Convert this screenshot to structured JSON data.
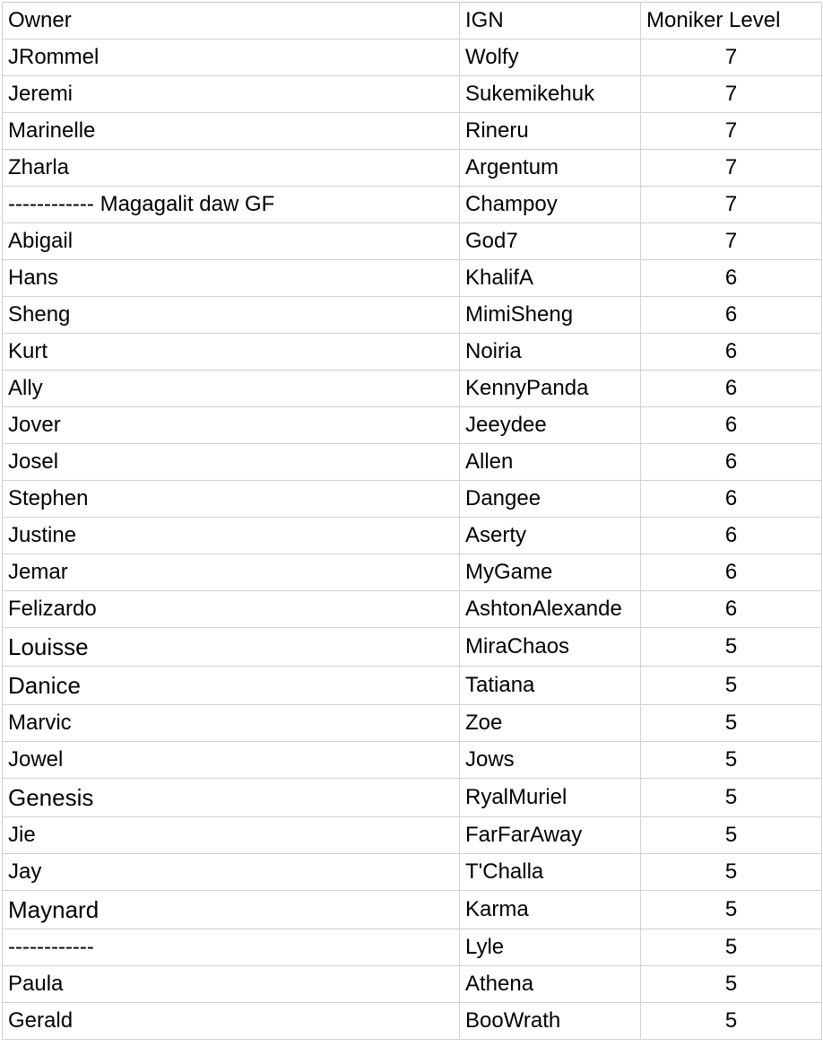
{
  "headers": {
    "owner": "Owner",
    "ign": "IGN",
    "level": "Moniker Level"
  },
  "rows": [
    {
      "owner": "JRommel",
      "ign": "Wolfy",
      "level": "7"
    },
    {
      "owner": "Jeremi",
      "ign": "Sukemikehuk",
      "level": "7"
    },
    {
      "owner": "Marinelle",
      "ign": "Rineru",
      "level": "7"
    },
    {
      "owner": "Zharla",
      "ign": "Argentum",
      "level": "7"
    },
    {
      "owner": "------------ Magagalit daw GF",
      "ign": "Champoy",
      "level": "7"
    },
    {
      "owner": "Abigail",
      "ign": "God7",
      "level": "7"
    },
    {
      "owner": "Hans",
      "ign": "KhalifA",
      "level": "6"
    },
    {
      "owner": "Sheng",
      "ign": "MimiSheng",
      "level": "6"
    },
    {
      "owner": "Kurt",
      "ign": "Noiria",
      "level": "6"
    },
    {
      "owner": "Ally",
      "ign": "KennyPanda",
      "level": "6"
    },
    {
      "owner": "Jover",
      "ign": "Jeeydee",
      "level": "6"
    },
    {
      "owner": "Josel",
      "ign": "Allen",
      "level": "6"
    },
    {
      "owner": "Stephen",
      "ign": "Dangee",
      "level": "6"
    },
    {
      "owner": "Justine",
      "ign": "Aserty",
      "level": "6"
    },
    {
      "owner": "Jemar",
      "ign": "MyGame",
      "level": "6"
    },
    {
      "owner": "Felizardo",
      "ign": "AshtonAlexande",
      "level": "6"
    },
    {
      "owner": "Louisse",
      "ign": "MiraChaos",
      "level": "5"
    },
    {
      "owner": "Danice",
      "ign": "Tatiana",
      "level": "5"
    },
    {
      "owner": "Marvic",
      "ign": "Zoe",
      "level": "5"
    },
    {
      "owner": "Jowel",
      "ign": "Jows",
      "level": "5"
    },
    {
      "owner": "Genesis",
      "ign": "RyalMuriel",
      "level": "5"
    },
    {
      "owner": "Jie",
      "ign": "FarFarAway",
      "level": "5"
    },
    {
      "owner": "Jay",
      "ign": "T'Challa",
      "level": "5"
    },
    {
      "owner": "Maynard",
      "ign": "Karma",
      "level": "5"
    },
    {
      "owner": "------------",
      "ign": "Lyle",
      "level": "5"
    },
    {
      "owner": "Paula",
      "ign": "Athena",
      "level": "5"
    },
    {
      "owner": "Gerald",
      "ign": "BooWrath",
      "level": "5"
    }
  ]
}
